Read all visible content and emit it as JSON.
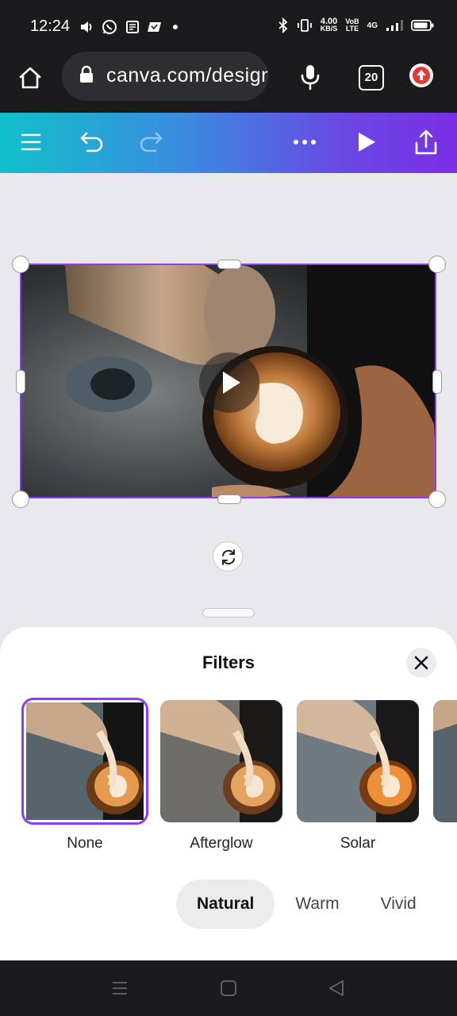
{
  "status_bar": {
    "time": "12:24",
    "net_speed": "4.00",
    "net_unit": "KB/S",
    "volte_top": "VoB",
    "volte_bottom": "LTE",
    "signal_label": "4G",
    "signal_level": 0.75,
    "battery_level": 0.85
  },
  "browser": {
    "url": "canva.com/design",
    "tab_count": "20"
  },
  "canva_toolbar": {
    "accent_start": "#11bfcb",
    "accent_end": "#7b2ee6"
  },
  "sheet": {
    "title": "Filters",
    "filters": [
      {
        "label": "None",
        "selected": true
      },
      {
        "label": "Afterglow",
        "selected": false
      },
      {
        "label": "Solar",
        "selected": false
      }
    ],
    "tabs": [
      {
        "label": "Natural",
        "active": true
      },
      {
        "label": "Warm",
        "active": false
      },
      {
        "label": "Vivid",
        "active": false
      }
    ],
    "selection_color": "#8b3dff"
  }
}
